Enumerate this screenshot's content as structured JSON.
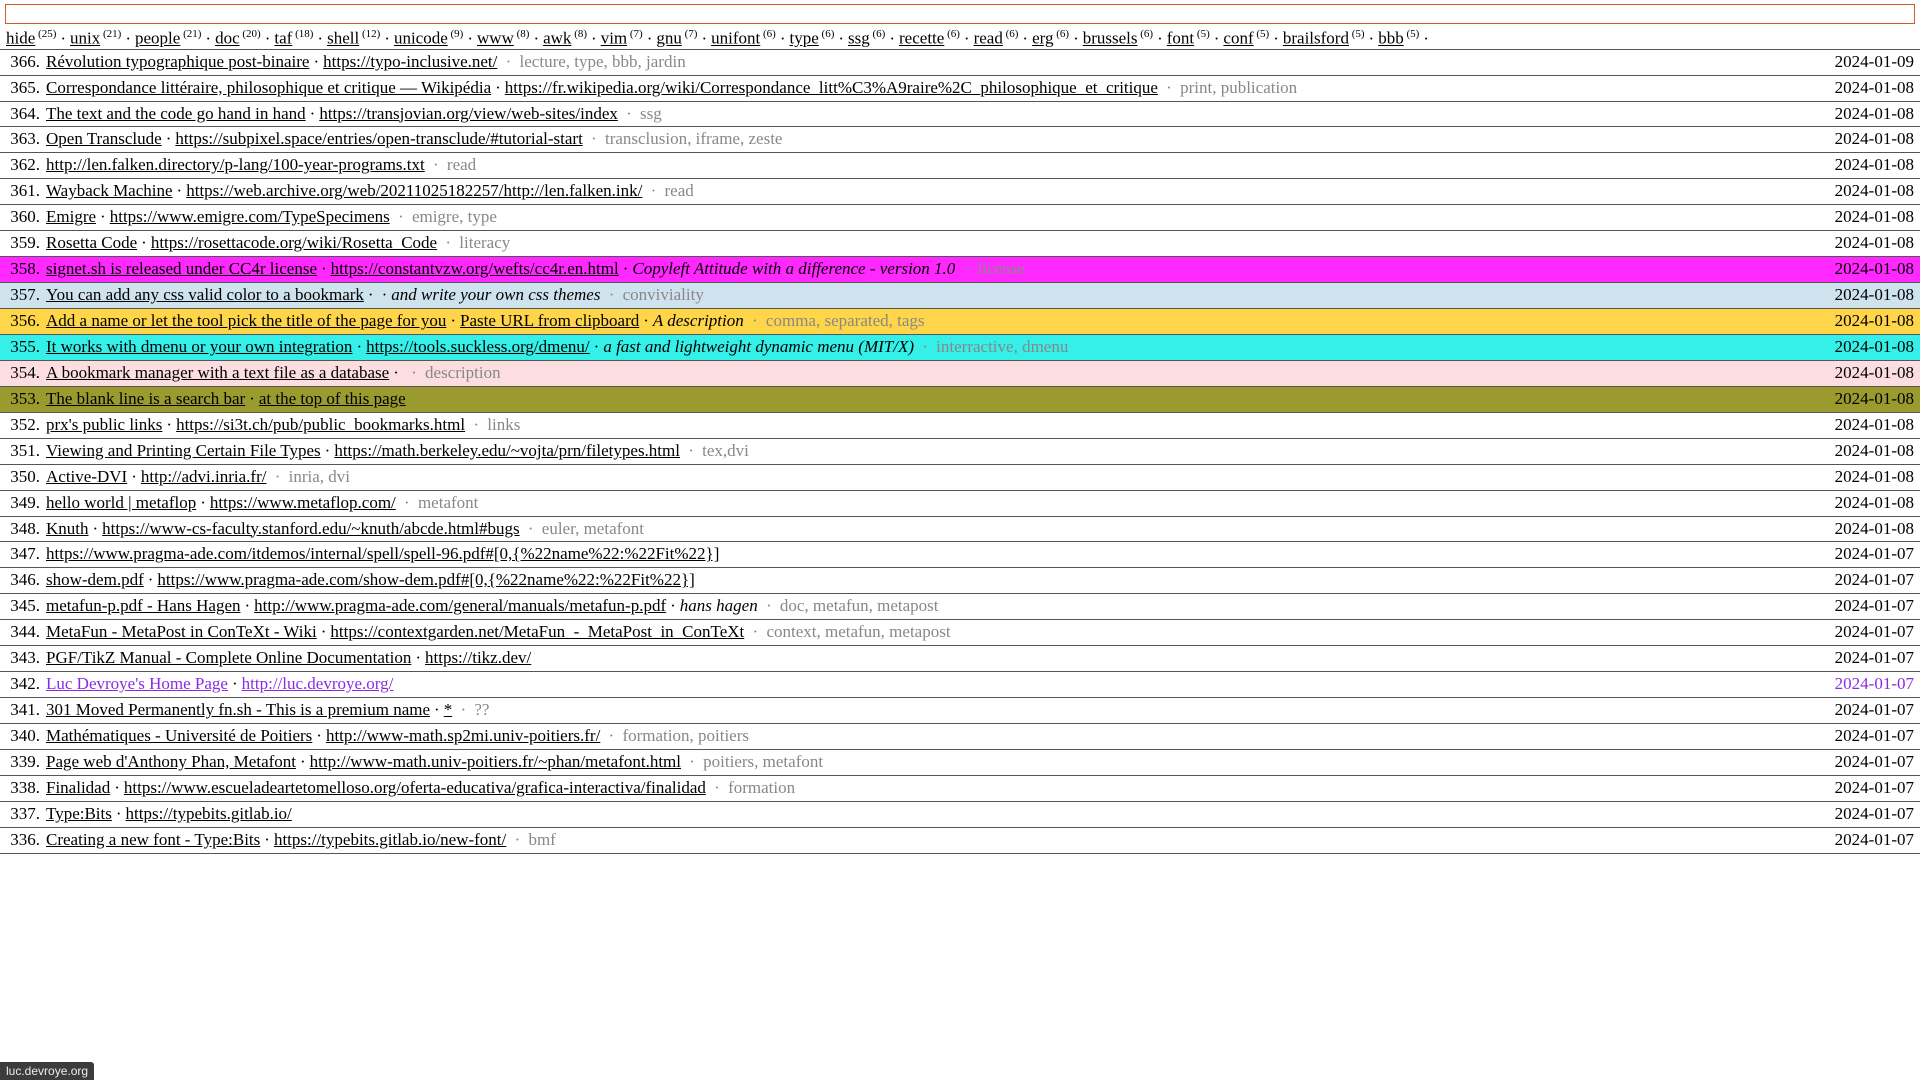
{
  "search": {
    "placeholder": ""
  },
  "tags": [
    {
      "name": "hide",
      "count": 25
    },
    {
      "name": "unix",
      "count": 21
    },
    {
      "name": "people",
      "count": 21
    },
    {
      "name": "doc",
      "count": 20
    },
    {
      "name": "taf",
      "count": 18
    },
    {
      "name": "shell",
      "count": 12
    },
    {
      "name": "unicode",
      "count": 9
    },
    {
      "name": "www",
      "count": 8
    },
    {
      "name": "awk",
      "count": 8
    },
    {
      "name": "vim",
      "count": 7
    },
    {
      "name": "gnu",
      "count": 7
    },
    {
      "name": "unifont",
      "count": 6
    },
    {
      "name": "type",
      "count": 6
    },
    {
      "name": "ssg",
      "count": 6
    },
    {
      "name": "recette",
      "count": 6
    },
    {
      "name": "read",
      "count": 6
    },
    {
      "name": "erg",
      "count": 6
    },
    {
      "name": "brussels",
      "count": 6
    },
    {
      "name": "font",
      "count": 5
    },
    {
      "name": "conf",
      "count": 5
    },
    {
      "name": "brailsford",
      "count": 5
    },
    {
      "name": "bbb",
      "count": 5
    }
  ],
  "status_bar": "luc.devroye.org",
  "bookmarks": [
    {
      "n": 366,
      "title": "Révolution typographique post-binaire",
      "url": "https://typo-inclusive.net/",
      "desc": "",
      "tags": "lecture, type, bbb, jardin",
      "date": "2024-01-09",
      "bg": ""
    },
    {
      "n": 365,
      "title": "Correspondance littéraire, philosophique et critique — Wikipédia",
      "url": "https://fr.wikipedia.org/wiki/Correspondance_litt%C3%A9raire%2C_philosophique_et_critique",
      "desc": "",
      "tags": "print, publication",
      "date": "2024-01-08",
      "bg": ""
    },
    {
      "n": 364,
      "title": "The text and the code go hand in hand",
      "url": "https://transjovian.org/view/web-sites/index",
      "desc": "",
      "tags": "ssg",
      "date": "2024-01-08",
      "bg": ""
    },
    {
      "n": 363,
      "title": "Open Transclude",
      "url": "https://subpixel.space/entries/open-transclude/#tutorial-start",
      "desc": "",
      "tags": "transclusion, iframe, zeste",
      "date": "2024-01-08",
      "bg": ""
    },
    {
      "n": 362,
      "title": "",
      "url": "http://len.falken.directory/p-lang/100-year-programs.txt",
      "desc": "",
      "tags": "read",
      "date": "2024-01-08",
      "bg": ""
    },
    {
      "n": 361,
      "title": "Wayback Machine",
      "url": "https://web.archive.org/web/20211025182257/http://len.falken.ink/",
      "desc": "",
      "tags": "read",
      "date": "2024-01-08",
      "bg": ""
    },
    {
      "n": 360,
      "title": "Emigre",
      "url": "https://www.emigre.com/TypeSpecimens",
      "desc": "",
      "tags": "emigre, type",
      "date": "2024-01-08",
      "bg": ""
    },
    {
      "n": 359,
      "title": "Rosetta Code",
      "url": "https://rosettacode.org/wiki/Rosetta_Code",
      "desc": "",
      "tags": "literacy",
      "date": "2024-01-08",
      "bg": ""
    },
    {
      "n": 358,
      "title": "signet.sh is released under CC4r license",
      "url": "https://constantvzw.org/wefts/cc4r.en.html",
      "desc": "Copyleft Attitude with a difference - version 1.0",
      "tags": "license",
      "date": "2024-01-08",
      "bg": "#ff29ff"
    },
    {
      "n": 357,
      "title": "You can add any css valid color to a bookmark",
      "url": "",
      "desc": "and write your own css themes",
      "tags": "conviviality",
      "date": "2024-01-08",
      "bg": "#cfe3ef"
    },
    {
      "n": 356,
      "title": "Add a name or let the tool pick the title of the page for you",
      "url": "Paste URL from clipboard",
      "desc": "A description",
      "tags": "comma, separated, tags",
      "date": "2024-01-08",
      "bg": "#ffd54a"
    },
    {
      "n": 355,
      "title": "It works with dmenu or your own integration",
      "url": "https://tools.suckless.org/dmenu/",
      "desc": "a fast and lightweight dynamic menu (MIT/X)",
      "tags": "interractive, dmenu",
      "date": "2024-01-08",
      "bg": "#34f0e8"
    },
    {
      "n": 354,
      "title": "A bookmark manager with a text file as a database",
      "url": "",
      "desc": "",
      "tags": "description",
      "date": "2024-01-08",
      "bg": "#fcdde0"
    },
    {
      "n": 353,
      "title": "The blank line is a search bar",
      "url": "at the top of this page",
      "desc": "",
      "tags": "",
      "date": "2024-01-08",
      "bg": "#9a9a2e"
    },
    {
      "n": 352,
      "title": "prx's public links",
      "url": "https://si3t.ch/pub/public_bookmarks.html",
      "desc": "",
      "tags": "links",
      "date": "2024-01-08",
      "bg": ""
    },
    {
      "n": 351,
      "title": "Viewing and Printing Certain File Types",
      "url": "https://math.berkeley.edu/~vojta/prn/filetypes.html",
      "desc": "",
      "tags": "tex,dvi",
      "date": "2024-01-08",
      "bg": ""
    },
    {
      "n": 350,
      "title": "Active-DVI",
      "url": "http://advi.inria.fr/",
      "desc": "",
      "tags": "inria, dvi",
      "date": "2024-01-08",
      "bg": ""
    },
    {
      "n": 349,
      "title": "hello world | metaflop",
      "url": "https://www.metaflop.com/",
      "desc": "",
      "tags": "metafont",
      "date": "2024-01-08",
      "bg": ""
    },
    {
      "n": 348,
      "title": "Knuth",
      "url": "https://www-cs-faculty.stanford.edu/~knuth/abcde.html#bugs",
      "desc": "",
      "tags": "euler, metafont",
      "date": "2024-01-08",
      "bg": ""
    },
    {
      "n": 347,
      "title": "",
      "url": "https://www.pragma-ade.com/itdemos/internal/spell/spell-96.pdf#[0,{%22name%22:%22Fit%22}]",
      "desc": "",
      "tags": "",
      "date": "2024-01-07",
      "bg": ""
    },
    {
      "n": 346,
      "title": "show-dem.pdf",
      "url": "https://www.pragma-ade.com/show-dem.pdf#[0,{%22name%22:%22Fit%22}]",
      "desc": "",
      "tags": "",
      "date": "2024-01-07",
      "bg": ""
    },
    {
      "n": 345,
      "title": "metafun-p.pdf - Hans Hagen",
      "url": "http://www.pragma-ade.com/general/manuals/metafun-p.pdf",
      "desc": "hans hagen",
      "tags": "doc, metafun, metapost",
      "date": "2024-01-07",
      "bg": ""
    },
    {
      "n": 344,
      "title": "MetaFun - MetaPost in ConTeXt - Wiki",
      "url": "https://contextgarden.net/MetaFun_-_MetaPost_in_ConTeXt",
      "desc": "",
      "tags": "context, metafun, metapost",
      "date": "2024-01-07",
      "bg": ""
    },
    {
      "n": 343,
      "title": "PGF/TikZ Manual - Complete Online Documentation",
      "url": "https://tikz.dev/",
      "desc": "",
      "tags": "",
      "date": "2024-01-07",
      "bg": ""
    },
    {
      "n": 342,
      "title": "Luc Devroye's Home Page",
      "url": "http://luc.devroye.org/",
      "desc": "",
      "tags": "",
      "date": "2024-01-07",
      "bg": "",
      "visited": true
    },
    {
      "n": 341,
      "title": "301 Moved Permanently fn.sh - This is a premium name",
      "url": "*",
      "desc": "",
      "tags": "??",
      "date": "2024-01-07",
      "bg": ""
    },
    {
      "n": 340,
      "title": "Mathématiques - Université de Poitiers",
      "url": "http://www-math.sp2mi.univ-poitiers.fr/",
      "desc": "",
      "tags": "formation, poitiers",
      "date": "2024-01-07",
      "bg": ""
    },
    {
      "n": 339,
      "title": "Page web d'Anthony Phan, Metafont",
      "url": "http://www-math.univ-poitiers.fr/~phan/metafont.html",
      "desc": "",
      "tags": "poitiers, metafont",
      "date": "2024-01-07",
      "bg": ""
    },
    {
      "n": 338,
      "title": "Finalidad",
      "url": "https://www.escueladeartetomelloso.org/oferta-educativa/grafica-interactiva/finalidad",
      "desc": "",
      "tags": "formation",
      "date": "2024-01-07",
      "bg": ""
    },
    {
      "n": 337,
      "title": "Type:Bits",
      "url": "https://typebits.gitlab.io/",
      "desc": "",
      "tags": "",
      "date": "2024-01-07",
      "bg": ""
    },
    {
      "n": 336,
      "title": "Creating a new font - Type:Bits",
      "url": "https://typebits.gitlab.io/new-font/",
      "desc": "",
      "tags": "bmf",
      "date": "2024-01-07",
      "bg": ""
    }
  ]
}
